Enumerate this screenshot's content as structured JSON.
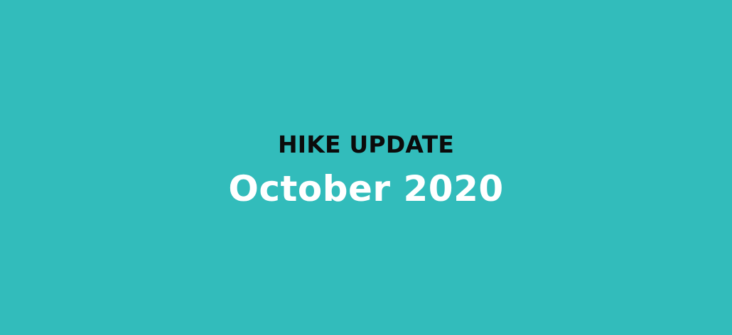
{
  "banner": {
    "eyebrow": "HIKE UPDATE",
    "headline": "October 2020",
    "background_color": "#32bcbb",
    "eyebrow_color": "#0b0b0b",
    "headline_color": "#ffffff"
  }
}
